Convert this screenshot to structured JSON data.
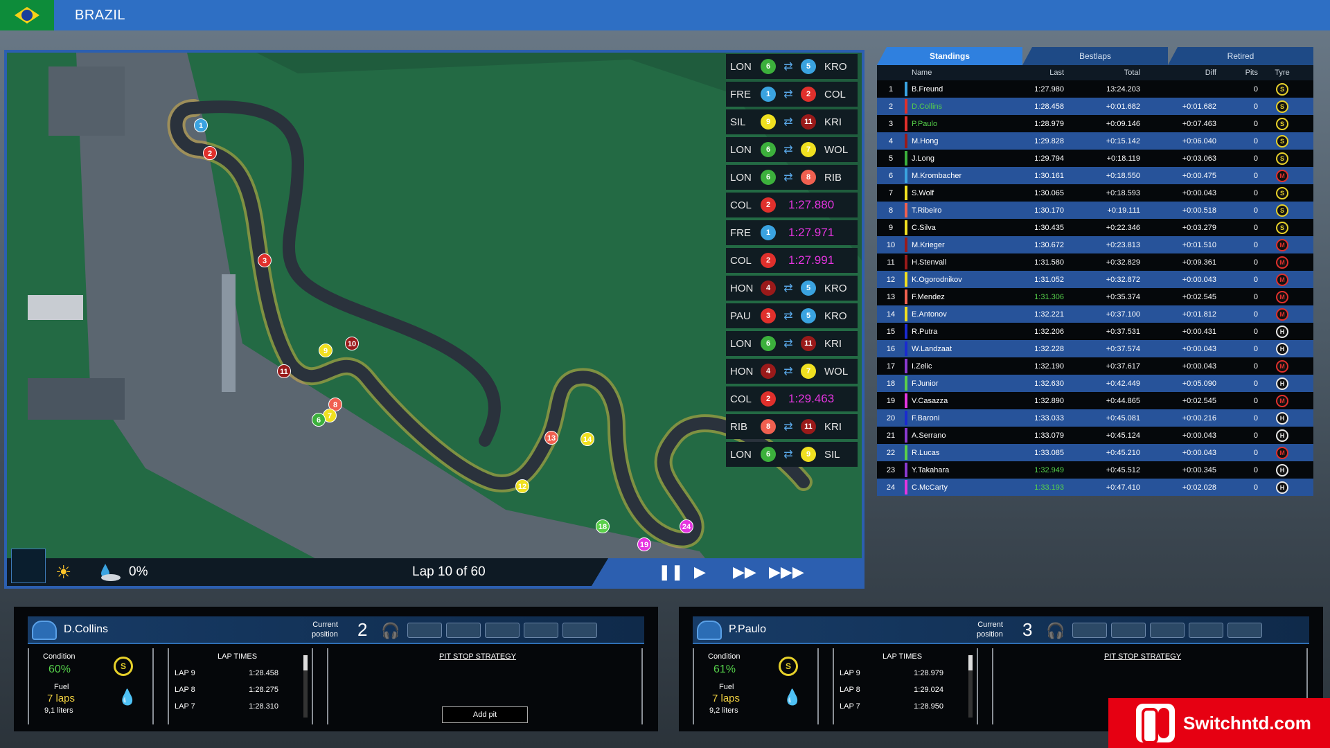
{
  "header": {
    "country": "BRAZIL"
  },
  "map": {
    "rain_percent": "0%",
    "lap_text": "Lap 10 of 60",
    "controls": {
      "pause": "❚❚",
      "play": "▶",
      "fast": "▶▶",
      "faster": "▶▶▶"
    },
    "car_markers": [
      {
        "num": "1",
        "color": "#3aa3e0"
      },
      {
        "num": "2",
        "color": "#e0302c"
      },
      {
        "num": "3",
        "color": "#e0302c"
      },
      {
        "num": "9",
        "color": "#f0e020"
      },
      {
        "num": "10",
        "color": "#9a1a1a"
      },
      {
        "num": "11",
        "color": "#9a1a1a"
      },
      {
        "num": "8",
        "color": "#f06050"
      },
      {
        "num": "7",
        "color": "#f0e020"
      },
      {
        "num": "6",
        "color": "#3cb03c"
      },
      {
        "num": "13",
        "color": "#f06050"
      },
      {
        "num": "14",
        "color": "#f0e020"
      },
      {
        "num": "12",
        "color": "#f0e020"
      },
      {
        "num": "18",
        "color": "#5ad04a"
      },
      {
        "num": "19",
        "color": "#e535e0"
      },
      {
        "num": "24",
        "color": "#e535e0"
      }
    ]
  },
  "battles": [
    {
      "a": "LON",
      "an": "6",
      "ac": "#3cb03c",
      "b": "KRO",
      "bn": "5",
      "bc": "#3aa3e0"
    },
    {
      "a": "FRE",
      "an": "1",
      "ac": "#3aa3e0",
      "b": "COL",
      "bn": "2",
      "bc": "#e0302c"
    },
    {
      "a": "SIL",
      "an": "9",
      "ac": "#f0e020",
      "b": "KRI",
      "bn": "11",
      "bc": "#9a1a1a"
    },
    {
      "a": "LON",
      "an": "6",
      "ac": "#3cb03c",
      "b": "WOL",
      "bn": "7",
      "bc": "#f0e020"
    },
    {
      "a": "LON",
      "an": "6",
      "ac": "#3cb03c",
      "b": "RIB",
      "bn": "8",
      "bc": "#f06050"
    },
    {
      "a": "COL",
      "an": "2",
      "ac": "#e0302c",
      "fast": "1:27.880"
    },
    {
      "a": "FRE",
      "an": "1",
      "ac": "#3aa3e0",
      "fast": "1:27.971"
    },
    {
      "a": "COL",
      "an": "2",
      "ac": "#e0302c",
      "fast": "1:27.991"
    },
    {
      "a": "HON",
      "an": "4",
      "ac": "#9a1a1a",
      "b": "KRO",
      "bn": "5",
      "bc": "#3aa3e0"
    },
    {
      "a": "PAU",
      "an": "3",
      "ac": "#e0302c",
      "b": "KRO",
      "bn": "5",
      "bc": "#3aa3e0"
    },
    {
      "a": "LON",
      "an": "6",
      "ac": "#3cb03c",
      "b": "KRI",
      "bn": "11",
      "bc": "#9a1a1a"
    },
    {
      "a": "HON",
      "an": "4",
      "ac": "#9a1a1a",
      "b": "WOL",
      "bn": "7",
      "bc": "#f0e020"
    },
    {
      "a": "COL",
      "an": "2",
      "ac": "#e0302c",
      "fast": "1:29.463"
    },
    {
      "a": "RIB",
      "an": "8",
      "ac": "#f06050",
      "b": "KRI",
      "bn": "11",
      "bc": "#9a1a1a"
    },
    {
      "a": "LON",
      "an": "6",
      "ac": "#3cb03c",
      "b": "SIL",
      "bn": "9",
      "bc": "#f0e020"
    }
  ],
  "standings": {
    "tabs": [
      "Standings",
      "Bestlaps",
      "Retired"
    ],
    "headers": {
      "name": "Name",
      "last": "Last",
      "total": "Total",
      "diff": "Diff",
      "pits": "Pits",
      "tyre": "Tyre"
    },
    "rows": [
      {
        "pos": "1",
        "name": "B.Freund",
        "last": "1:27.980",
        "total": "13:24.203",
        "diff": "",
        "pits": "0",
        "tyre": "S",
        "bar": "#3aa3e0"
      },
      {
        "pos": "2",
        "name": "D.Collins",
        "last": "1:28.458",
        "total": "+0:01.682",
        "diff": "+0:01.682",
        "pits": "0",
        "tyre": "S",
        "bar": "#e0302c",
        "hl": "#55d04a"
      },
      {
        "pos": "3",
        "name": "P.Paulo",
        "last": "1:28.979",
        "total": "+0:09.146",
        "diff": "+0:07.463",
        "pits": "0",
        "tyre": "S",
        "bar": "#e0302c",
        "hl": "#55d04a"
      },
      {
        "pos": "4",
        "name": "M.Hong",
        "last": "1:29.828",
        "total": "+0:15.142",
        "diff": "+0:06.040",
        "pits": "0",
        "tyre": "S",
        "bar": "#9a1a1a"
      },
      {
        "pos": "5",
        "name": "J.Long",
        "last": "1:29.794",
        "total": "+0:18.119",
        "diff": "+0:03.063",
        "pits": "0",
        "tyre": "S",
        "bar": "#3cb03c"
      },
      {
        "pos": "6",
        "name": "M.Krombacher",
        "last": "1:30.161",
        "total": "+0:18.550",
        "diff": "+0:00.475",
        "pits": "0",
        "tyre": "M",
        "bar": "#3aa3e0"
      },
      {
        "pos": "7",
        "name": "S.Wolf",
        "last": "1:30.065",
        "total": "+0:18.593",
        "diff": "+0:00.043",
        "pits": "0",
        "tyre": "S",
        "bar": "#f0e020"
      },
      {
        "pos": "8",
        "name": "T.Ribeiro",
        "last": "1:30.170",
        "total": "+0:19.111",
        "diff": "+0:00.518",
        "pits": "0",
        "tyre": "S",
        "bar": "#f06050"
      },
      {
        "pos": "9",
        "name": "C.Silva",
        "last": "1:30.435",
        "total": "+0:22.346",
        "diff": "+0:03.279",
        "pits": "0",
        "tyre": "S",
        "bar": "#f0e020"
      },
      {
        "pos": "10",
        "name": "M.Krieger",
        "last": "1:30.672",
        "total": "+0:23.813",
        "diff": "+0:01.510",
        "pits": "0",
        "tyre": "M",
        "bar": "#9a1a1a"
      },
      {
        "pos": "11",
        "name": "H.Stenvall",
        "last": "1:31.580",
        "total": "+0:32.829",
        "diff": "+0:09.361",
        "pits": "0",
        "tyre": "M",
        "bar": "#9a1a1a"
      },
      {
        "pos": "12",
        "name": "K.Ogorodnikov",
        "last": "1:31.052",
        "total": "+0:32.872",
        "diff": "+0:00.043",
        "pits": "0",
        "tyre": "M",
        "bar": "#f0e020"
      },
      {
        "pos": "13",
        "name": "F.Mendez",
        "last": "1:31.306",
        "total": "+0:35.374",
        "diff": "+0:02.545",
        "pits": "0",
        "tyre": "M",
        "bar": "#f06050",
        "lastc": "#55d04a"
      },
      {
        "pos": "14",
        "name": "E.Antonov",
        "last": "1:32.221",
        "total": "+0:37.100",
        "diff": "+0:01.812",
        "pits": "0",
        "tyre": "M",
        "bar": "#f0e020"
      },
      {
        "pos": "15",
        "name": "R.Putra",
        "last": "1:32.206",
        "total": "+0:37.531",
        "diff": "+0:00.431",
        "pits": "0",
        "tyre": "H",
        "bar": "#1a2ad0"
      },
      {
        "pos": "16",
        "name": "W.Landzaat",
        "last": "1:32.228",
        "total": "+0:37.574",
        "diff": "+0:00.043",
        "pits": "0",
        "tyre": "H",
        "bar": "#1a2ad0"
      },
      {
        "pos": "17",
        "name": "I.Zelic",
        "last": "1:32.190",
        "total": "+0:37.617",
        "diff": "+0:00.043",
        "pits": "0",
        "tyre": "M",
        "bar": "#8a3ad0"
      },
      {
        "pos": "18",
        "name": "F.Junior",
        "last": "1:32.630",
        "total": "+0:42.449",
        "diff": "+0:05.090",
        "pits": "0",
        "tyre": "H",
        "bar": "#5ad04a"
      },
      {
        "pos": "19",
        "name": "V.Casazza",
        "last": "1:32.890",
        "total": "+0:44.865",
        "diff": "+0:02.545",
        "pits": "0",
        "tyre": "M",
        "bar": "#e535e0"
      },
      {
        "pos": "20",
        "name": "F.Baroni",
        "last": "1:33.033",
        "total": "+0:45.081",
        "diff": "+0:00.216",
        "pits": "0",
        "tyre": "H",
        "bar": "#1a2ad0"
      },
      {
        "pos": "21",
        "name": "A.Serrano",
        "last": "1:33.079",
        "total": "+0:45.124",
        "diff": "+0:00.043",
        "pits": "0",
        "tyre": "H",
        "bar": "#8a3ad0"
      },
      {
        "pos": "22",
        "name": "R.Lucas",
        "last": "1:33.085",
        "total": "+0:45.210",
        "diff": "+0:00.043",
        "pits": "0",
        "tyre": "M",
        "bar": "#5ad04a"
      },
      {
        "pos": "23",
        "name": "Y.Takahara",
        "last": "1:32.949",
        "total": "+0:45.512",
        "diff": "+0:00.345",
        "pits": "0",
        "tyre": "H",
        "bar": "#8a3ad0",
        "lastc": "#55d04a"
      },
      {
        "pos": "24",
        "name": "C.McCarty",
        "last": "1:33.193",
        "total": "+0:47.410",
        "diff": "+0:02.028",
        "pits": "0",
        "tyre": "H",
        "bar": "#e535e0",
        "lastc": "#55d04a"
      }
    ]
  },
  "driver1": {
    "name": "D.Collins",
    "current_label_1": "Current",
    "current_label_2": "position",
    "position": "2",
    "condition_label": "Condition",
    "condition_value": "60%",
    "tyre": "S",
    "fuel_label": "Fuel",
    "fuel_laps": "7 laps",
    "fuel_liters": "9,1 liters",
    "lap_times_title": "LAP TIMES",
    "laps": [
      {
        "lap": "LAP 9",
        "time": "1:28.458"
      },
      {
        "lap": "LAP 8",
        "time": "1:28.275"
      },
      {
        "lap": "LAP 7",
        "time": "1:28.310"
      }
    ],
    "pit_title": "PIT STOP STRATEGY",
    "add_pit": "Add pit"
  },
  "driver2": {
    "name": "P.Paulo",
    "current_label_1": "Current",
    "current_label_2": "position",
    "position": "3",
    "condition_label": "Condition",
    "condition_value": "61%",
    "tyre": "S",
    "fuel_label": "Fuel",
    "fuel_laps": "7 laps",
    "fuel_liters": "9,2 liters",
    "lap_times_title": "LAP TIMES",
    "laps": [
      {
        "lap": "LAP 9",
        "time": "1:28.979"
      },
      {
        "lap": "LAP 8",
        "time": "1:29.024"
      },
      {
        "lap": "LAP 7",
        "time": "1:28.950"
      }
    ],
    "pit_title": "PIT STOP STRATEGY"
  },
  "watermark": {
    "text": "Switchntd.com"
  }
}
